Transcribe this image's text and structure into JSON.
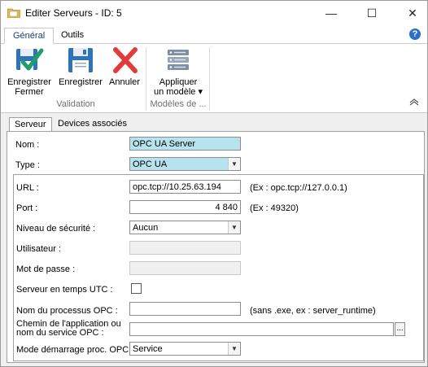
{
  "window": {
    "title": "Editer Serveurs - ID: 5",
    "controls": {
      "minimize": "—",
      "maximize": "☐",
      "close": "✕"
    }
  },
  "ribbon": {
    "tabs": [
      {
        "label": "Général",
        "active": true
      },
      {
        "label": "Outils",
        "active": false
      }
    ],
    "help": "?",
    "buttons": {
      "save_close": {
        "line1": "Enregistrer",
        "line2": "Fermer",
        "icon": "save-close-icon"
      },
      "save": {
        "label": "Enregistrer",
        "icon": "floppy-disk-icon"
      },
      "cancel": {
        "label": "Annuler",
        "icon": "red-x-icon"
      },
      "apply_template": {
        "line1": "Appliquer",
        "line2": "un modèle ▾",
        "icon": "template-icon"
      }
    },
    "groups": {
      "validation": "Validation",
      "templates": "Modèles de ..."
    }
  },
  "inner_tabs": [
    {
      "label": "Serveur",
      "active": true
    },
    {
      "label": "Devices associés",
      "active": false
    }
  ],
  "form": {
    "nom": {
      "label": "Nom :",
      "value": "OPC UA Server"
    },
    "type": {
      "label": "Type :",
      "value": "OPC UA"
    },
    "url": {
      "label": "URL :",
      "value": "opc.tcp://10.25.63.194",
      "hint": "(Ex : opc.tcp://127.0.0.1)"
    },
    "port": {
      "label": "Port :",
      "value": "4 840",
      "hint": "(Ex : 49320)"
    },
    "security": {
      "label": "Niveau de sécurité :",
      "value": "Aucun"
    },
    "user": {
      "label": "Utilisateur :",
      "value": ""
    },
    "password": {
      "label": "Mot de passe :",
      "value": ""
    },
    "utc": {
      "label": "Serveur en temps UTC :",
      "checked": false
    },
    "process": {
      "label": "Nom du processus OPC :",
      "value": "",
      "hint": "(sans .exe, ex : server_runtime)"
    },
    "path": {
      "label_line1": "Chemin de l'application ou",
      "label_line2": "nom du service OPC :",
      "value": "",
      "browse": "..."
    },
    "start_mode": {
      "label": "Mode démarrage proc. OPC :",
      "value": "Service"
    }
  },
  "colors": {
    "accent": "#1a3e7c",
    "field_highlight": "#b7e3ef",
    "cancel_red": "#e03c3c",
    "check_green": "#1e9e6a"
  }
}
